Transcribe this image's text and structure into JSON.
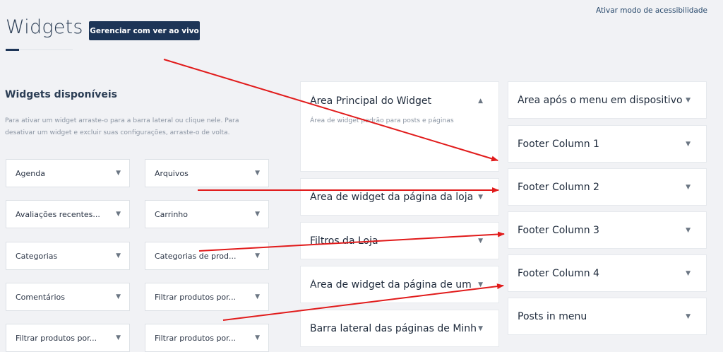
{
  "header": {
    "title": "Widgets",
    "manage_button": "Gerenciar com ver ao vivo",
    "accessibility_link": "Ativar modo de acessibilidade"
  },
  "available": {
    "title": "Widgets disponíveis",
    "description": "Para ativar um widget arraste-o para a barra lateral ou clique nele. Para desativar um widget e excluir suas configurações, arraste-o de volta.",
    "items": [
      "Agenda",
      "Arquivos",
      "Avaliações recentes...",
      "Carrinho",
      "Categorias",
      "Categorias de prod...",
      "Comentários",
      "Filtrar produtos por...",
      "Filtrar produtos por...",
      "Filtrar produtos por..."
    ]
  },
  "sidebars_left": [
    {
      "name": "Área Principal do Widget",
      "description": "Área de widget padrão para posts e páginas",
      "expanded": true
    },
    {
      "name": "Área de widget da página da loja"
    },
    {
      "name": "Filtros da Loja"
    },
    {
      "name": "Área de widget da página de um"
    },
    {
      "name": "Barra lateral das páginas de Minh"
    }
  ],
  "sidebars_right": [
    {
      "name": "Área após o menu em dispositivo"
    },
    {
      "name": "Footer Column 1"
    },
    {
      "name": "Footer Column 2"
    },
    {
      "name": "Footer Column 3"
    },
    {
      "name": "Footer Column 4"
    },
    {
      "name": "Posts in menu"
    }
  ],
  "icons": {
    "caret_down": "▼",
    "caret_up": "▲"
  },
  "colors": {
    "primary": "#1d3557",
    "arrow": "#e11b1b",
    "background": "#f1f2f5"
  }
}
